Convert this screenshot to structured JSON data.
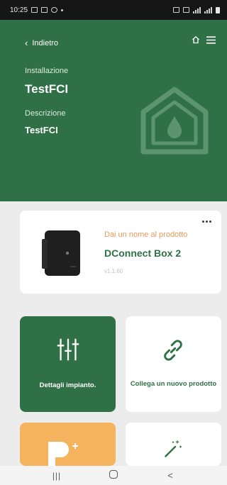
{
  "status_bar": {
    "time": "10:25"
  },
  "header": {
    "back_label": "Indietro",
    "installation_label": "Installazione",
    "installation_name": "TestFCI",
    "description_label": "Descrizione",
    "description_value": "TestFCI"
  },
  "product_card": {
    "name_hint": "Dai un nome al prodotto",
    "product_name": "DConnect Box 2",
    "version": "v1.1.60"
  },
  "tiles": [
    {
      "label": "Dettagli impianto.",
      "icon": "sliders-icon"
    },
    {
      "label": "Collega un nuovo prodotto",
      "icon": "link-icon"
    },
    {
      "label": "",
      "icon": "plant-logo-icon"
    },
    {
      "label": "",
      "icon": "magic-wand-icon"
    }
  ],
  "colors": {
    "brand_green": "#2f7046",
    "accent_orange": "#f4b35c",
    "name_hint_orange": "#e39a5d"
  }
}
